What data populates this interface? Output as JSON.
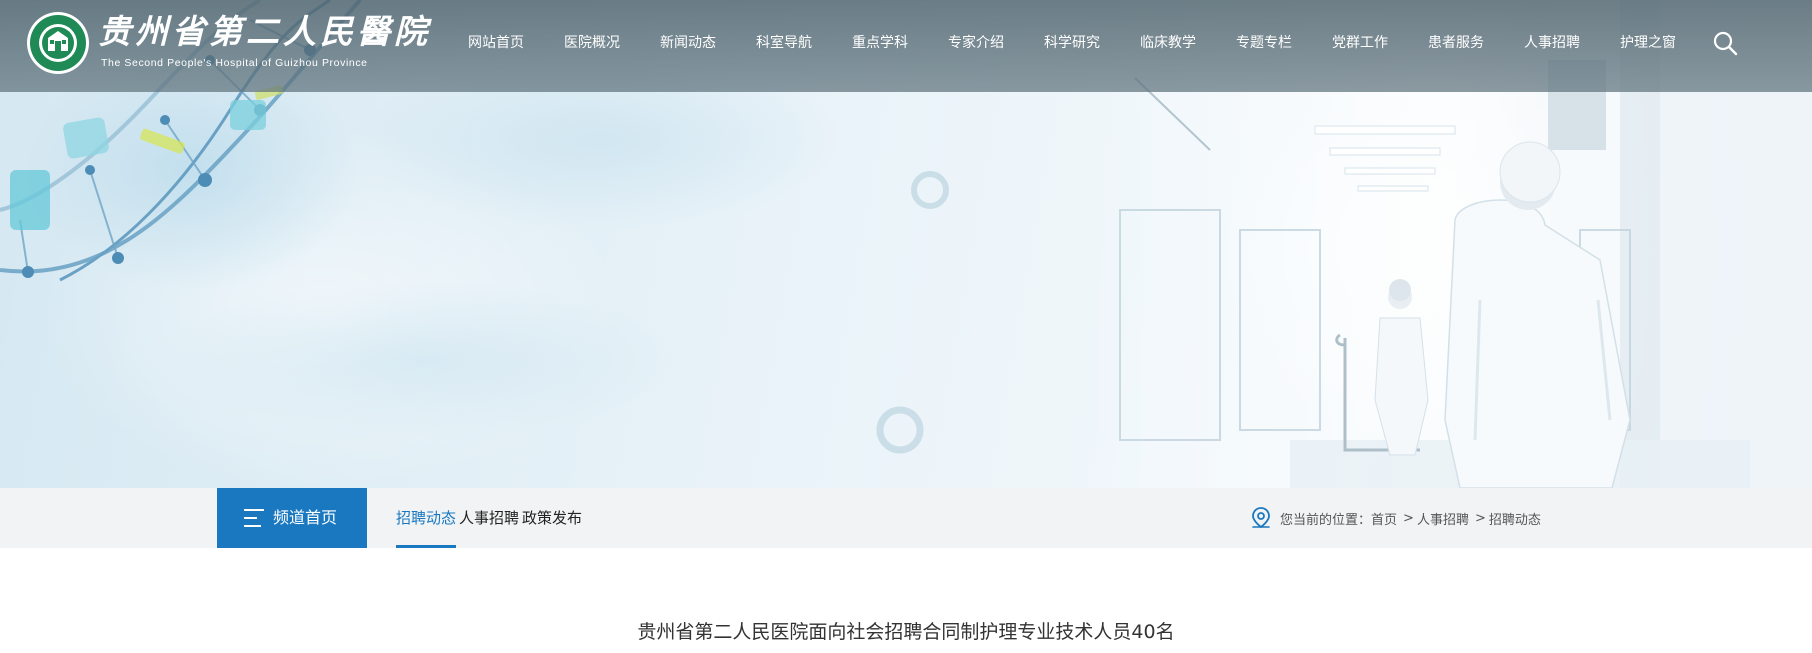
{
  "header": {
    "brand_cn": "贵州省第二人民醫院",
    "brand_en": "The Second People's Hospital of Guizhou Province",
    "nav": [
      "网站首页",
      "医院概况",
      "新闻动态",
      "科室导航",
      "重点学科",
      "专家介绍",
      "科学研究",
      "临床教学",
      "专题专栏",
      "党群工作",
      "患者服务",
      "人事招聘",
      "护理之窗"
    ],
    "search_icon": "search-icon"
  },
  "subnav": {
    "channel_label": "频道首页",
    "channel_icon": "menu-icon",
    "tabs": [
      "招聘动态",
      "人事招聘",
      "政策发布"
    ],
    "active_tab": "招聘动态",
    "location_icon": "location-pin-icon",
    "breadcrumb_prefix": "您当前的位置：",
    "breadcrumb": [
      "首页",
      "人事招聘",
      "招聘动态"
    ]
  },
  "article": {
    "title": "贵州省第二人民医院面向社会招聘合同制护理专业技术人员40名"
  },
  "colors": {
    "accent": "#1a78c0",
    "header_bg": "#5b6f79",
    "subbar_bg": "#f2f3f4"
  }
}
